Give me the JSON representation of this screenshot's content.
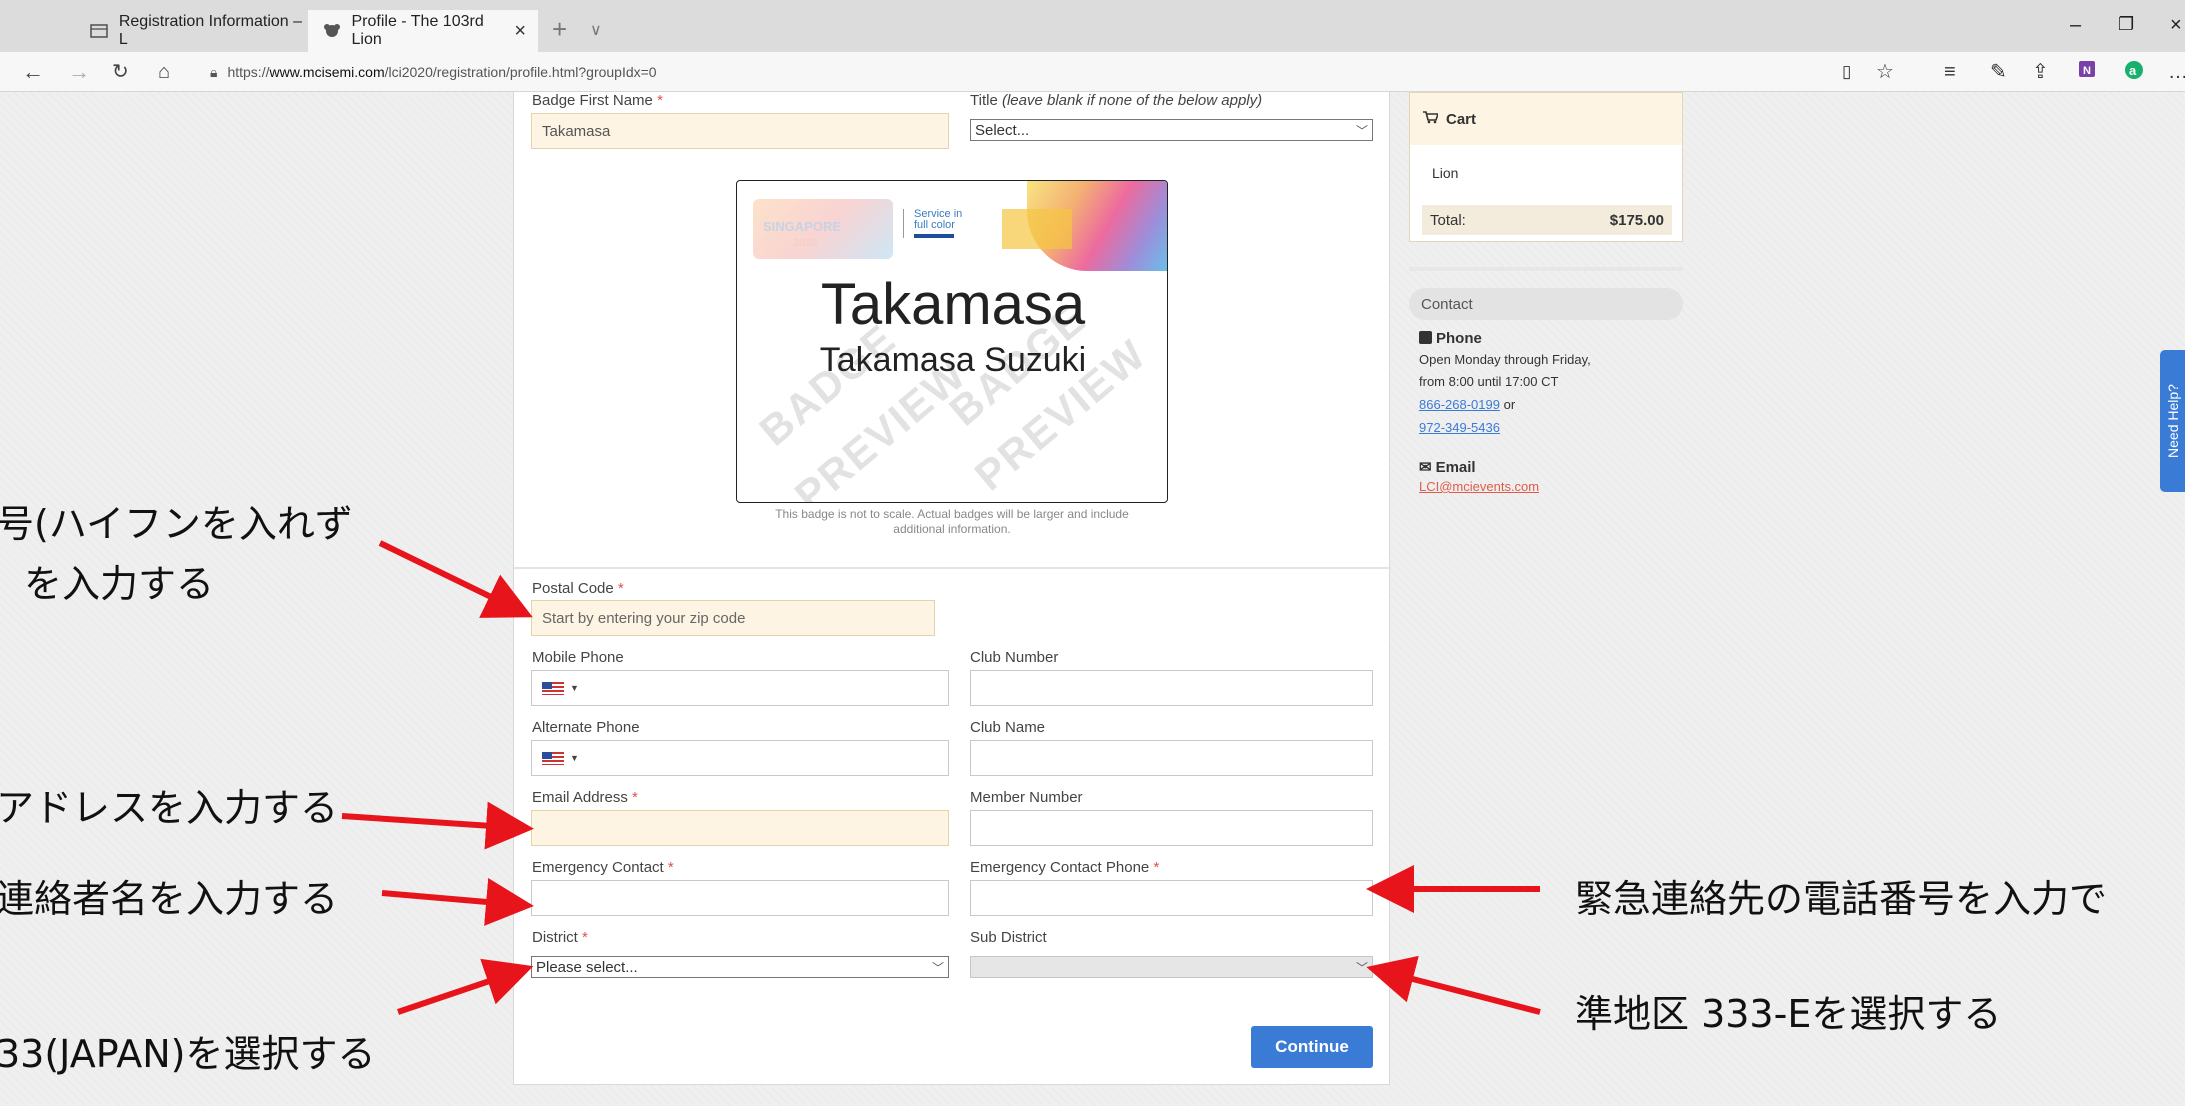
{
  "browser": {
    "tabs": [
      {
        "label": "Registration Information – L"
      },
      {
        "label": "Profile - The 103rd Lion"
      }
    ],
    "url_prefix": "https://",
    "url_host": "www.mcisemi.com",
    "url_path": "/lci2020/registration/profile.html?groupIdx=0"
  },
  "form": {
    "badge_first_name_label": "Badge First Name",
    "badge_first_name_value": "Takamasa",
    "title_label": "Title",
    "title_hint": "(leave blank if none of the below apply)",
    "title_value": "Select...",
    "required_mark": "*",
    "postal_code_label": "Postal Code",
    "postal_code_placeholder": "Start by entering your zip code",
    "mobile_phone_label": "Mobile Phone",
    "club_number_label": "Club Number",
    "alternate_phone_label": "Alternate Phone",
    "club_name_label": "Club Name",
    "email_label": "Email Address",
    "member_number_label": "Member Number",
    "emergency_contact_label": "Emergency Contact",
    "emergency_phone_label": "Emergency Contact Phone",
    "district_label": "District",
    "district_value": "Please select...",
    "sub_district_label": "Sub District",
    "continue_label": "Continue"
  },
  "badge": {
    "first_name": "Takamasa",
    "full_name": "Takamasa Suzuki",
    "logo_text": "SINGAPORE",
    "logo_year": "2020",
    "service_line1": "Service in",
    "service_line2": "full color",
    "watermark_a": "BADGE",
    "watermark_b": "PREVIEW",
    "note_line1": "This badge is not to scale. Actual badges will be larger and include",
    "note_line2": "additional information."
  },
  "cart": {
    "title": "Cart",
    "item": "Lion",
    "total_label": "Total:",
    "total_value": "$175.00"
  },
  "contact": {
    "title": "Contact",
    "phone_heading": "Phone",
    "hours_line1": "Open Monday through Friday,",
    "hours_line2": "from 8:00 until 17:00 CT",
    "phone1": "866-268-0199",
    "or": "or",
    "phone2": "972-349-5436",
    "email_heading": "Email",
    "email": "LCI@mcievents.com"
  },
  "help_tab": "Need Help?",
  "annotations": {
    "postal_line1": "号(ハイフンを入れず",
    "postal_line2": "を入力する",
    "email": "アドレスを入力する",
    "emergency_name": "連絡者名を入力する",
    "emergency_phone": "緊急連絡先の電話番号を入力で",
    "district": "33(JAPAN)を選択する",
    "sub_district": "準地区 333-Eを選択する"
  },
  "colors": {
    "accent": "#3a7bd5",
    "required": "#d9534f",
    "arrow": "#e8141c",
    "highlight_field": "#fdf4e3"
  }
}
